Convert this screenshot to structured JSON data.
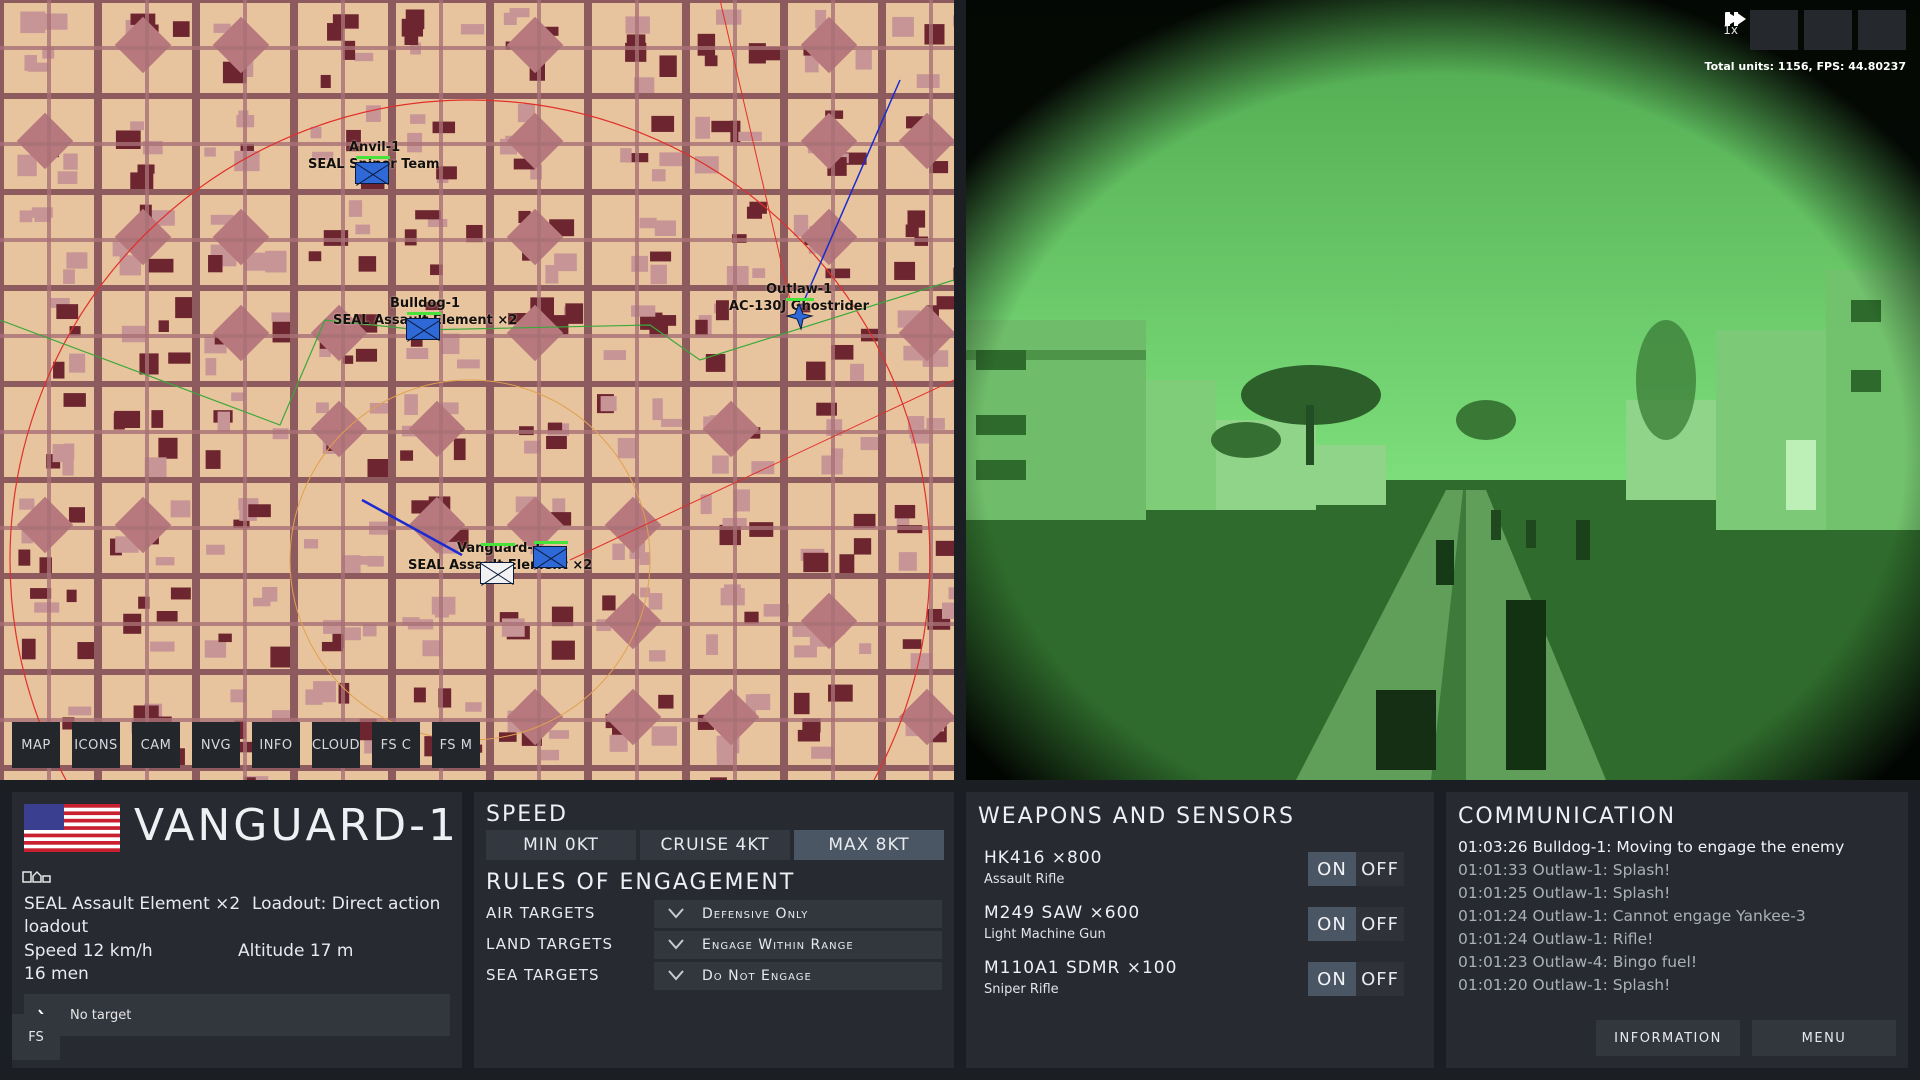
{
  "map": {
    "units": [
      {
        "name": "Anvil-1",
        "type": "SEAL Sniper Team"
      },
      {
        "name": "Bulldog-1",
        "type": "SEAL Assault Element ×2"
      },
      {
        "name": "Outlaw-1",
        "type": "AC-130J Ghostrider"
      },
      {
        "name": "Vanguard-1",
        "type": "SEAL Assault Element ×2"
      }
    ],
    "toolbar": [
      "MAP",
      "ICONS",
      "CAM",
      "NVG",
      "INFO",
      "CLOUD",
      "FS C",
      "FS M"
    ]
  },
  "camera": {
    "speed_multiplier": "1x",
    "pause_icon": "pause-icon",
    "play_icon": "play-icon",
    "fast_forward_icon": "fast-forward-icon",
    "stats": "Total units: 1156, FPS: 44.80237"
  },
  "unit_panel": {
    "flag_icon": "us-flag-icon",
    "title": "VANGUARD-1",
    "icons": "unit-type-icons",
    "type_line": "SEAL Assault Element ×2",
    "loadout_line": "Loadout: Direct action",
    "loadout_line2": "loadout",
    "speed": "Speed 12 km/h",
    "altitude": "Altitude 17 m",
    "men": "16 men",
    "target": "No target",
    "fs_label": "FS"
  },
  "speed_panel": {
    "title": "SPEED",
    "options": [
      "MIN 0KT",
      "CRUISE 4KT",
      "MAX 8KT"
    ],
    "selected": "MAX 8KT",
    "roe_title": "RULES OF ENGAGEMENT",
    "roe": [
      {
        "label": "AIR TARGETS",
        "value": "Defensive Only"
      },
      {
        "label": "LAND TARGETS",
        "value": "Engage Within Range"
      },
      {
        "label": "SEA TARGETS",
        "value": "Do Not Engage"
      }
    ]
  },
  "weapons_panel": {
    "title": "WEAPONS AND SENSORS",
    "weapons": [
      {
        "name": "HK416 ×800",
        "type": "Assault Rifle",
        "on": "ON",
        "off": "OFF"
      },
      {
        "name": "M249 SAW ×600",
        "type": "Light Machine Gun",
        "on": "ON",
        "off": "OFF"
      },
      {
        "name": "M110A1 SDMR ×100",
        "type": "Sniper Rifle",
        "on": "ON",
        "off": "OFF"
      }
    ]
  },
  "comm_panel": {
    "title": "COMMUNICATION",
    "log": [
      "01:03:26 Bulldog-1: Moving to engage the enemy",
      "01:01:33 Outlaw-1: Splash!",
      "01:01:25 Outlaw-1: Splash!",
      "01:01:24 Outlaw-1: Cannot engage Yankee-3",
      "01:01:24 Outlaw-1: Rifle!",
      "01:01:23 Outlaw-4: Bingo fuel!",
      "01:01:20 Outlaw-1: Splash!"
    ],
    "info_button": "INFORMATION",
    "menu_button": "MENU"
  },
  "colors": {
    "panel_bg": "#272a30",
    "accent_active": "#4a5663",
    "map_ground": "#e8c49e",
    "friendly_unit": "#2f69d8",
    "nvg_green": "#5fcf63"
  }
}
